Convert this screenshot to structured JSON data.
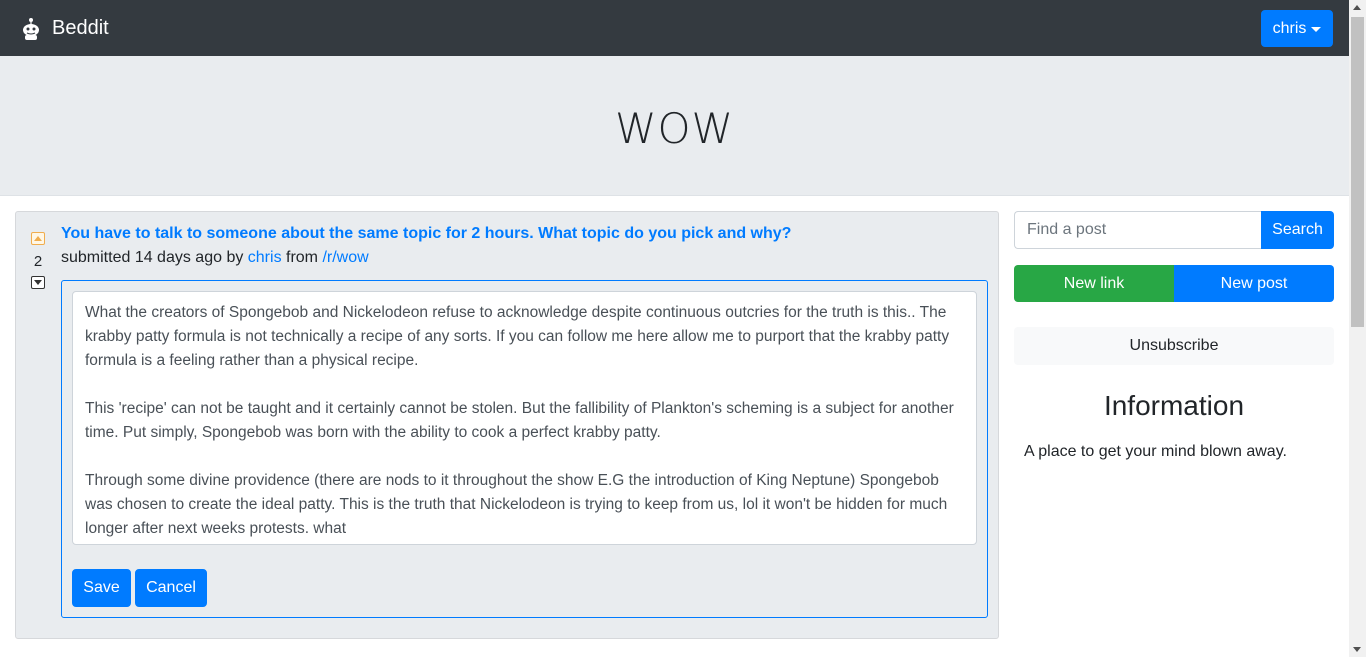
{
  "navbar": {
    "brand": "Beddit",
    "user_menu": "chris"
  },
  "header": {
    "title": "WOW"
  },
  "post": {
    "score": "2",
    "title": "You have to talk to someone about the same topic for 2 hours. What topic do you pick and why?",
    "meta_prefix": "submitted 14 days ago by ",
    "author": "chris",
    "meta_from": " from ",
    "subreddit": "/r/wow",
    "body_paragraphs": [
      "What the creators of Spongebob and Nickelodeon refuse to acknowledge despite continuous outcries for the truth is this.. The krabby patty formula is not technically a recipe of any sorts. If you can follow me here allow me to purport that the krabby patty formula is a feeling rather than a physical recipe.",
      "This 'recipe' can not be taught and it certainly cannot be stolen. But the fallibility of Plankton's scheming is a subject for another time. Put simply, Spongebob was born with the ability to cook a perfect krabby patty.",
      "Through some divine providence (there are nods to it throughout the show E.G the introduction of King Neptune) Spongebob was chosen to create the ideal patty. This is the truth that Nickelodeon is trying to keep from us, lol it won't be hidden for much longer after next weeks protests. what"
    ],
    "save_label": "Save",
    "cancel_label": "Cancel"
  },
  "sidebar": {
    "search_placeholder": "Find a post",
    "search_label": "Search",
    "new_link_label": "New link",
    "new_post_label": "New post",
    "unsubscribe_label": "Unsubscribe",
    "info_title": "Information",
    "info_text": "A place to get your mind blown away."
  },
  "colors": {
    "navbar": "#343a40",
    "primary": "#007bff",
    "success": "#28a745",
    "jumbotron": "#e9ecef"
  }
}
